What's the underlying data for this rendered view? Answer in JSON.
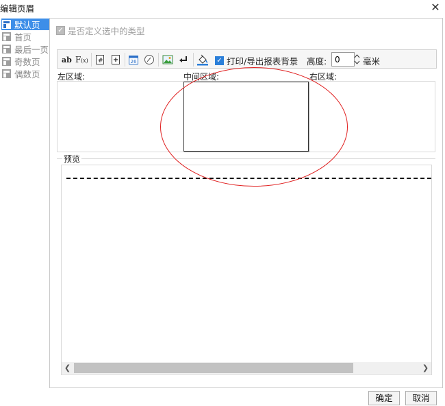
{
  "dialog": {
    "title": "编辑页眉"
  },
  "sidebar": {
    "items": [
      {
        "label": "默认页",
        "selected": true
      },
      {
        "label": "首页",
        "selected": false
      },
      {
        "label": "最后一页",
        "selected": false
      },
      {
        "label": "奇数页",
        "selected": false
      },
      {
        "label": "偶数页",
        "selected": false
      }
    ]
  },
  "type_option": {
    "label": "是否定义选中的类型",
    "checked": true,
    "enabled": false
  },
  "toolbar": {
    "print_bg_label": "打印/导出报表背景",
    "print_bg_checked": true,
    "height_label": "高度:",
    "height_value": "0",
    "unit_label": "毫米"
  },
  "areas": {
    "left_label": "左区域:",
    "middle_label": "中间区域:",
    "right_label": "右区域:"
  },
  "preview": {
    "label": "预览"
  },
  "buttons": {
    "ok": "确定",
    "cancel": "取消"
  },
  "colors": {
    "accent": "#3d8ee8",
    "annotation": "#e02020"
  },
  "icons": [
    "ab-text-icon",
    "formula-icon",
    "page-number-icon",
    "total-pages-icon",
    "date-icon",
    "time-icon",
    "image-icon",
    "line-break-icon",
    "paint-bucket-icon",
    "close-icon",
    "scroll-left-icon",
    "scroll-right-icon",
    "spin-up-icon",
    "spin-down-icon"
  ]
}
